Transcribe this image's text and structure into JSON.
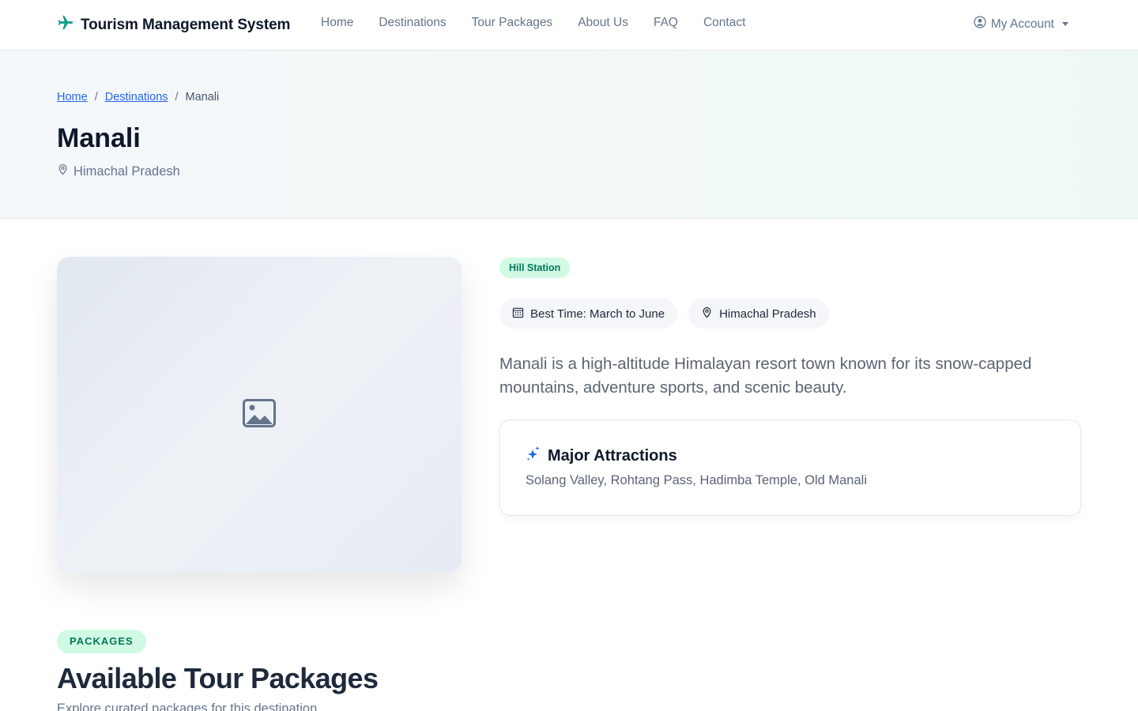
{
  "navbar": {
    "brand": "Tourism Management System",
    "links": [
      "Home",
      "Destinations",
      "Tour Packages",
      "About Us",
      "FAQ",
      "Contact"
    ],
    "account_label": "My Account"
  },
  "hero": {
    "breadcrumb": {
      "home": "Home",
      "destinations": "Destinations",
      "current": "Manali",
      "separator": "/"
    },
    "title": "Manali",
    "location": "Himachal Pradesh"
  },
  "destination": {
    "category": "Hill Station",
    "best_time": "Best Time: March to June",
    "state": "Himachal Pradesh",
    "description": "Manali is a high-altitude Himalayan resort town known for its snow-capped mountains, adventure sports, and scenic beauty.",
    "attractions_title": "Major Attractions",
    "attractions": "Solang Valley, Rohtang Pass, Hadimba Temple, Old Manali"
  },
  "packages": {
    "badge": "PACKAGES",
    "title": "Available Tour Packages",
    "subtitle": "Explore curated packages for this destination."
  },
  "colors": {
    "accent_green": "#0d9488",
    "link_blue": "#2563eb",
    "badge_bg": "#d1fae5",
    "badge_text": "#047857"
  }
}
